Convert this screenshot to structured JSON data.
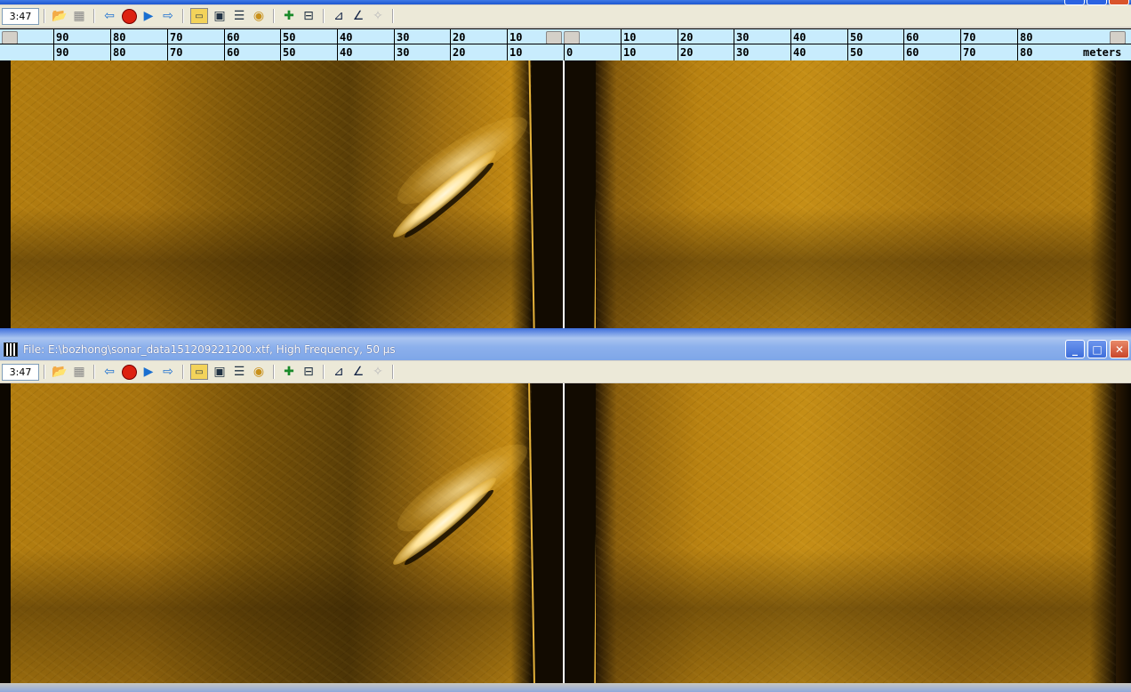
{
  "window1": {
    "toolbar": {
      "time": "3:47",
      "icons": [
        "open-folder-icon",
        "print-icon",
        "rewind-icon",
        "stop-icon",
        "play-icon",
        "forward-icon",
        "ruler-icon",
        "image-icon",
        "equalizer-icon",
        "palette-icon",
        "add-marker-icon",
        "remove-marker-icon",
        "measure-icon",
        "angle-icon",
        "clear-icon"
      ]
    },
    "ruler_top": {
      "left_ticks": [
        "90",
        "80",
        "70",
        "60",
        "50",
        "40",
        "30",
        "20",
        "10"
      ],
      "right_ticks": [
        "10",
        "20",
        "30",
        "40",
        "50",
        "60",
        "70",
        "80"
      ]
    },
    "ruler_bottom": {
      "left_ticks": [
        "90",
        "80",
        "70",
        "60",
        "50",
        "40",
        "30",
        "20",
        "10"
      ],
      "center_tick": "0",
      "right_ticks": [
        "10",
        "20",
        "30",
        "40",
        "50",
        "60",
        "70",
        "80"
      ],
      "unit": "meters"
    }
  },
  "window2": {
    "title": "File: E:\\bozhong\\sonar_data151209221200.xtf, High Frequency, 50 µs",
    "buttons": {
      "minimize": "_",
      "maximize": "□",
      "close": "✕"
    },
    "toolbar": {
      "time": "3:47"
    }
  },
  "colors": {
    "ruler_bg": "#c8ecfd",
    "sonar_amber": "#b27d10",
    "title_blue": "#7ea6e8"
  }
}
